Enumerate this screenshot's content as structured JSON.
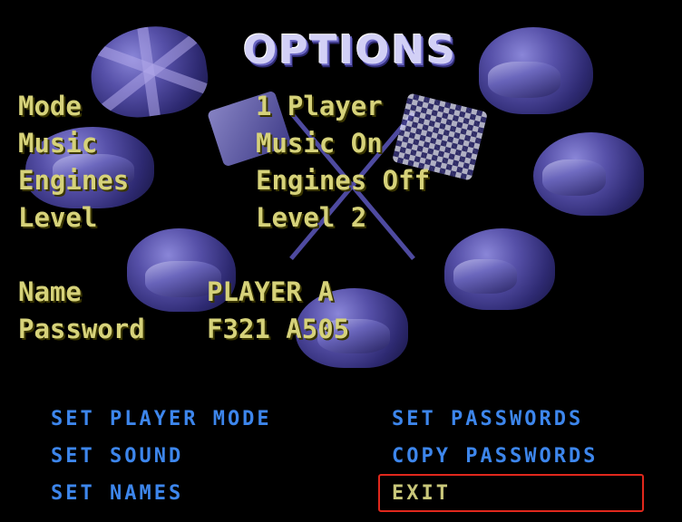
{
  "title": "OPTIONS",
  "settings": [
    {
      "label": "Mode",
      "value": "1 Player"
    },
    {
      "label": "Music",
      "value": "Music On"
    },
    {
      "label": "Engines",
      "value": "Engines Off"
    },
    {
      "label": "Level",
      "value": "Level 2"
    }
  ],
  "player": {
    "name_label": "Name",
    "name_value": "PLAYER A",
    "password_label": "Password",
    "password_value": "F321 A505"
  },
  "menu": {
    "set_player_mode": "SET PLAYER MODE",
    "set_sound": "SET SOUND",
    "set_names": "SET NAMES",
    "set_passwords": "SET PASSWORDS",
    "copy_passwords": "COPY PASSWORDS",
    "exit": "EXIT",
    "selected": "EXIT"
  },
  "colors": {
    "background": "#000000",
    "option_text": "#d6d27a",
    "menu_text": "#3d86ec",
    "selection_border": "#e0281c",
    "title": "#d2d0f6"
  }
}
